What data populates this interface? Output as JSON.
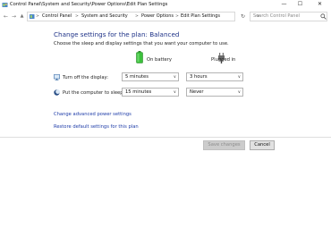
{
  "window": {
    "title": "Control Panel\\System and Security\\Power Options\\Edit Plan Settings",
    "controls": {
      "minimize": "—",
      "maximize": "☐",
      "close": "✕"
    }
  },
  "address_bar": {
    "back_glyph": "←",
    "forward_glyph": "→",
    "up_glyph": "▲",
    "breadcrumb": [
      "Control Panel",
      "System and Security",
      "Power Options",
      "Edit Plan Settings"
    ],
    "separator": ">",
    "dropdown_glyph": "∨",
    "refresh_glyph": "↻",
    "search_placeholder": "Search Control Panel"
  },
  "main": {
    "heading": "Change settings for the plan: Balanced",
    "subtitle": "Choose the sleep and display settings that you want your computer to use.",
    "columns": {
      "on_battery": "On battery",
      "plugged_in": "Plugged in"
    },
    "settings": [
      {
        "label": "Turn off the display:",
        "on_battery": "5 minutes",
        "plugged_in": "3 hours",
        "icon": "monitor-icon"
      },
      {
        "label": "Put the computer to sleep:",
        "on_battery": "15 minutes",
        "plugged_in": "Never",
        "icon": "moon-icon"
      }
    ],
    "select_chevron": "∨",
    "links": {
      "advanced": "Change advanced power settings",
      "restore": "Restore default settings for this plan"
    },
    "buttons": {
      "save": "Save changes",
      "cancel": "Cancel"
    }
  },
  "colors": {
    "heading": "#1e3287",
    "link": "#1e3ca8",
    "battery_green": "#3cc13c"
  }
}
